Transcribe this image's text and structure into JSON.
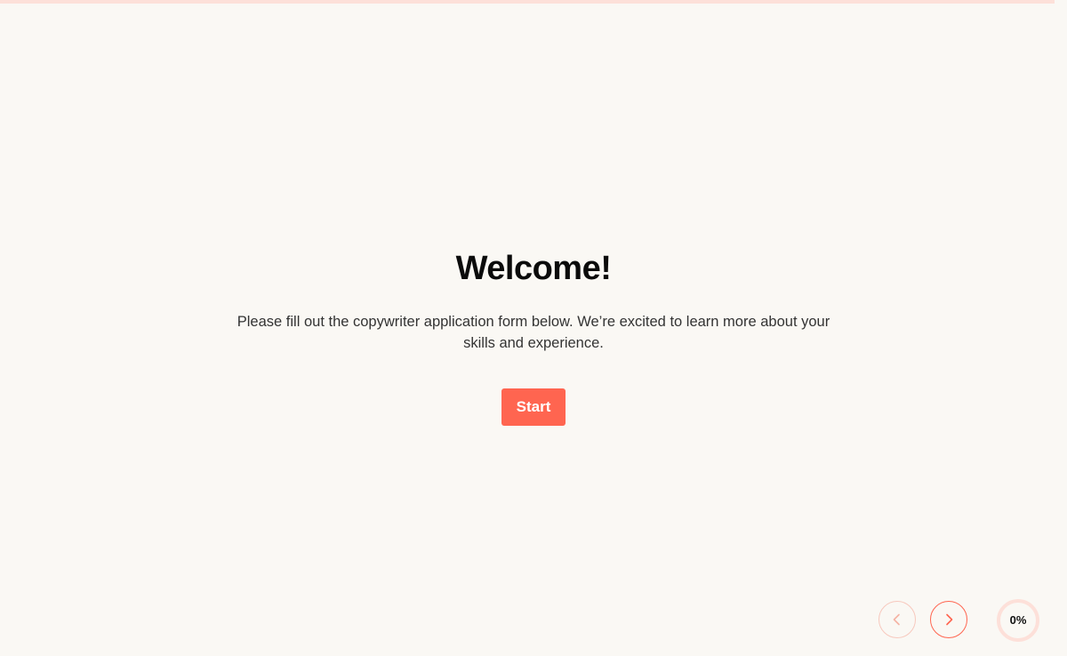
{
  "progress": {
    "fraction": 0.0,
    "label": "0%"
  },
  "welcome": {
    "title": "Welcome!",
    "description": "Please fill out the copywriter application form below. We’re excited to learn more about your skills and experience.",
    "start_label": "Start"
  },
  "navigation": {
    "prev_icon": "chevron-left-icon",
    "next_icon": "chevron-right-icon"
  },
  "colors": {
    "accent": "#ff6550",
    "accent_light": "#fde0d9",
    "background": "#faf8f4",
    "title": "#0b0b0b",
    "body_text": "#333333"
  }
}
